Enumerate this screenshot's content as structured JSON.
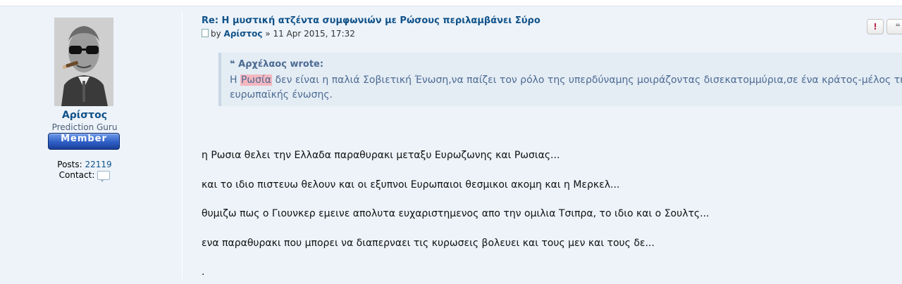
{
  "profile": {
    "username": "Αρίστος",
    "rank": "Prediction Guru",
    "rank_badge": "Member",
    "posts_label": "Posts:",
    "posts_count": "22119",
    "contact_label": "Contact:"
  },
  "post": {
    "title": "Re: Η μυστική ατζέντα συμφωνιών με Ρώσους περιλαμβάνει Σύρο",
    "meta_by": "by",
    "author": "Αρίστος",
    "meta_sep": "»",
    "date": "11 Apr 2015, 17:32",
    "report_label": "!",
    "quote_label": "❝"
  },
  "quote": {
    "author": "Αρχέλαος wrote:",
    "line1_prefix": "Η",
    "highlight": "Ρωσία",
    "line1_rest": "δεν είναι η παλιά Σοβιετική Ένωση,να παίζει τον ρόλο της υπερδύναμης μοιράζοντας δισεκατομμύρια,σε ένα κράτος-μέλος της",
    "line2": "ευρωπαϊκής ένωσης."
  },
  "body": [
    "η Ρωσια θελει την Ελλαδα παραθυρακι μεταξυ Ευρωζωνης και Ρωσιας...",
    "και το ιδιο πιστευω θελουν και οι εξυπνοι Ευρωπαιοι θεσμικοι ακομη και η Μερκελ...",
    "θυμιζω πως ο Γιουνκερ εμεινε απολυτα ευχαριστημενος απο την ομιλια Τσιπρα, το ιδιο και ο Σουλτς...",
    "ενα παραθυρακι που μπορει να διαπερναει τις κυρωσεις βολευει και τους μεν και τους δε...",
    "."
  ],
  "colors": {
    "post_bg": "#edf3f9",
    "link": "#105289",
    "quote_text": "#4c6b93",
    "highlight": "#f5b7c0"
  }
}
